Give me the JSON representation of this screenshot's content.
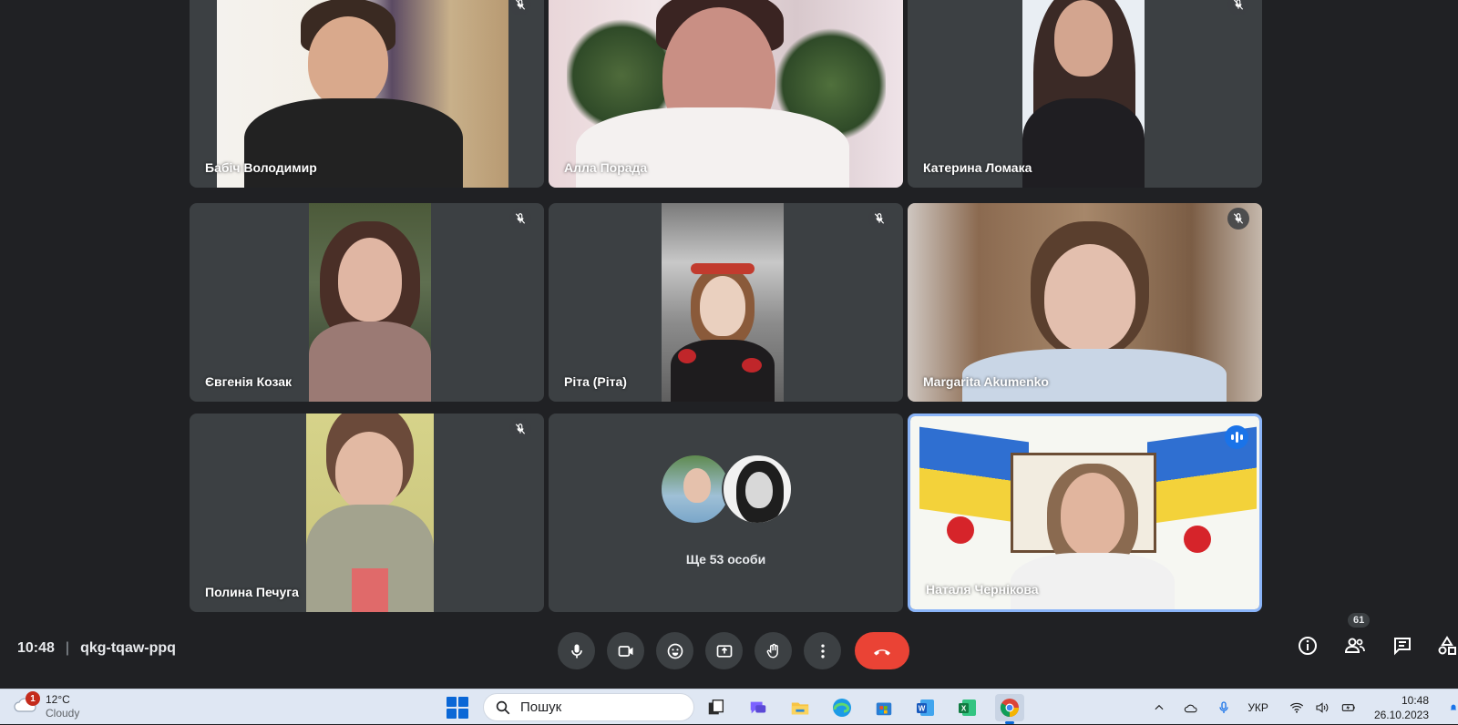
{
  "meeting": {
    "time": "10:48",
    "code": "qkg-tqaw-ppq",
    "participants_badge": "61"
  },
  "tiles": [
    {
      "name": "Бабіч Володимир",
      "muted": true
    },
    {
      "name": "Алла Порада",
      "muted": false
    },
    {
      "name": "Катерина Ломака",
      "muted": true
    },
    {
      "name": "Євгенія Козак",
      "muted": true
    },
    {
      "name": "Ріта (Ріта)",
      "muted": true
    },
    {
      "name": "Margarita Akumenko",
      "muted": true
    },
    {
      "name": "Полина Печуга",
      "muted": true
    },
    {
      "name": "Наталя Чернікова",
      "muted": false,
      "speaking": true
    }
  ],
  "more_tile": {
    "label": "Ще 53 особи"
  },
  "controls": {
    "icons": [
      "mic-icon",
      "camera-icon",
      "emoji-icon",
      "present-icon",
      "raise-hand-icon",
      "more-options-icon",
      "end-call-icon"
    ],
    "right_icons": [
      "info-icon",
      "people-icon",
      "chat-icon",
      "activities-icon"
    ]
  },
  "taskbar": {
    "weather_badge": "1",
    "temperature": "12°C",
    "condition": "Cloudy",
    "search_placeholder": "Пошук",
    "language": "УКР",
    "clock_time": "10:48",
    "clock_date": "26.10.2023",
    "apps": [
      "task-view-icon",
      "chat-app-icon",
      "file-explorer-icon",
      "edge-icon",
      "store-icon",
      "word-icon",
      "excel-icon",
      "chrome-icon"
    ]
  },
  "colors": {
    "background": "#202124",
    "tile": "#3c4043",
    "end_call": "#ea4335",
    "speaking_border": "#8ab4f8"
  }
}
